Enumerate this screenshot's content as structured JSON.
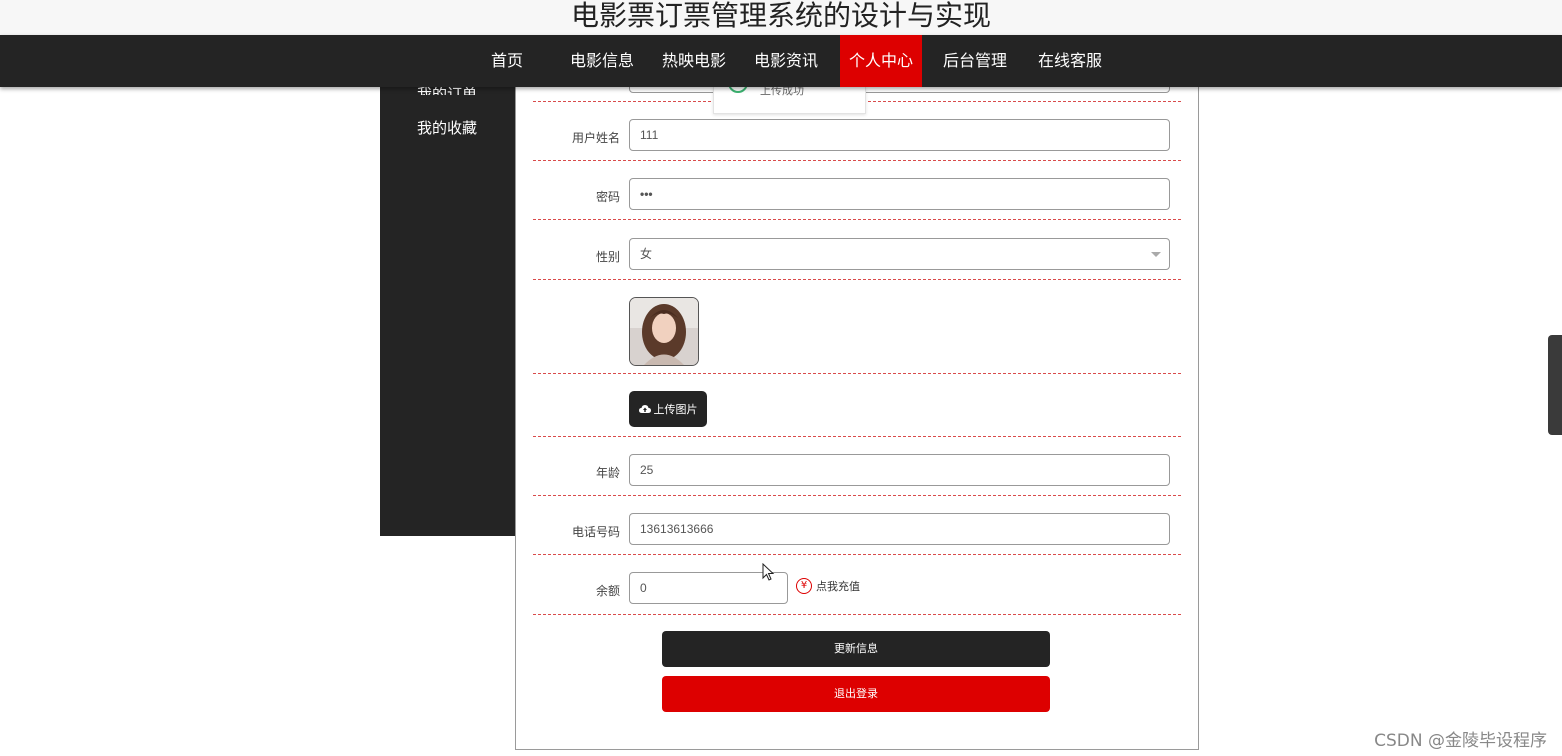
{
  "site": {
    "title": "电影票订票管理系统的设计与实现"
  },
  "nav": {
    "items": [
      {
        "label": "首页"
      },
      {
        "label": "电影信息"
      },
      {
        "label": "热映电影"
      },
      {
        "label": "电影资讯"
      },
      {
        "label": "个人中心",
        "active": true
      },
      {
        "label": "后台管理"
      },
      {
        "label": "在线客服"
      }
    ]
  },
  "sidebar": {
    "items": [
      {
        "label": "我的订单"
      },
      {
        "label": "我的收藏"
      }
    ]
  },
  "toast": {
    "text": "上传成功"
  },
  "form": {
    "username_label": "用户姓名",
    "username_value": "111",
    "password_label": "密码",
    "password_value": "•••",
    "gender_label": "性别",
    "gender_value": "女",
    "upload_label": "上传图片",
    "age_label": "年龄",
    "age_value": "25",
    "phone_label": "电话号码",
    "phone_value": "13613613666",
    "balance_label": "余额",
    "balance_value": "0",
    "recharge_label": "点我充值",
    "recharge_icon": "¥"
  },
  "buttons": {
    "update_label": "更新信息",
    "logout_label": "退出登录"
  },
  "watermark": {
    "text": "CSDN @金陵毕设程序"
  },
  "colors": {
    "accent": "#dd0000",
    "dark": "#242424",
    "divider": "#d94b4b"
  },
  "icons": {
    "upload": "cloud-upload-icon",
    "recharge": "yuan-icon",
    "success": "check-circle-icon"
  }
}
